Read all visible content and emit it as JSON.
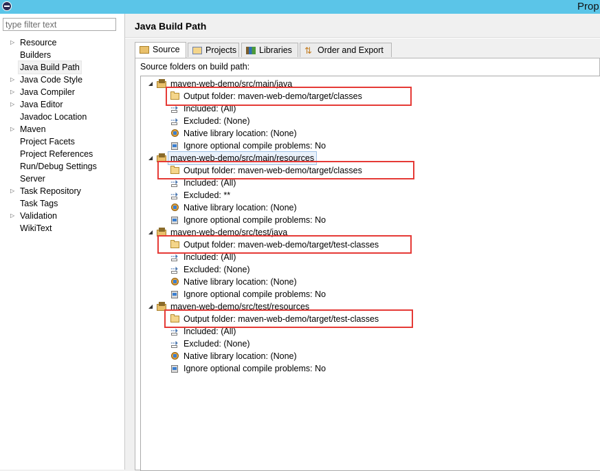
{
  "window": {
    "title": "Prop"
  },
  "filter": {
    "placeholder": "type filter text"
  },
  "nav": {
    "items": [
      {
        "label": "Resource",
        "expandable": true
      },
      {
        "label": "Builders",
        "expandable": false
      },
      {
        "label": "Java Build Path",
        "expandable": false,
        "selected": true
      },
      {
        "label": "Java Code Style",
        "expandable": true
      },
      {
        "label": "Java Compiler",
        "expandable": true
      },
      {
        "label": "Java Editor",
        "expandable": true
      },
      {
        "label": "Javadoc Location",
        "expandable": false
      },
      {
        "label": "Maven",
        "expandable": true
      },
      {
        "label": "Project Facets",
        "expandable": false
      },
      {
        "label": "Project References",
        "expandable": false
      },
      {
        "label": "Run/Debug Settings",
        "expandable": false
      },
      {
        "label": "Server",
        "expandable": false
      },
      {
        "label": "Task Repository",
        "expandable": true
      },
      {
        "label": "Task Tags",
        "expandable": false
      },
      {
        "label": "Validation",
        "expandable": true
      },
      {
        "label": "WikiText",
        "expandable": false
      }
    ]
  },
  "page": {
    "title": "Java Build Path"
  },
  "tabs": [
    {
      "label": "Source",
      "active": true
    },
    {
      "label": "Projects",
      "active": false
    },
    {
      "label": "Libraries",
      "active": false
    },
    {
      "label": "Order and Export",
      "active": false
    }
  ],
  "source": {
    "label": "Source folders on build path:",
    "folders": [
      {
        "name": "maven-web-demo/src/main/java",
        "selected": false,
        "output": "Output folder: maven-web-demo/target/classes",
        "included": "Included: (All)",
        "excluded": "Excluded: (None)",
        "native": "Native library location: (None)",
        "ignore": "Ignore optional compile problems: No"
      },
      {
        "name": "maven-web-demo/src/main/resources",
        "selected": true,
        "output": "Output folder: maven-web-demo/target/classes",
        "included": "Included: (All)",
        "excluded": "Excluded: **",
        "native": "Native library location: (None)",
        "ignore": "Ignore optional compile problems: No"
      },
      {
        "name": "maven-web-demo/src/test/java",
        "selected": false,
        "output": "Output folder: maven-web-demo/target/test-classes",
        "included": "Included: (All)",
        "excluded": "Excluded: (None)",
        "native": "Native library location: (None)",
        "ignore": "Ignore optional compile problems: No"
      },
      {
        "name": "maven-web-demo/src/test/resources",
        "selected": false,
        "output": "Output folder: maven-web-demo/target/test-classes",
        "included": "Included: (All)",
        "excluded": "Excluded: (None)",
        "native": "Native library location: (None)",
        "ignore": "Ignore optional compile problems: No"
      }
    ]
  },
  "colors": {
    "titlebar": "#5bc5e8",
    "highlight_box": "#e53935"
  }
}
